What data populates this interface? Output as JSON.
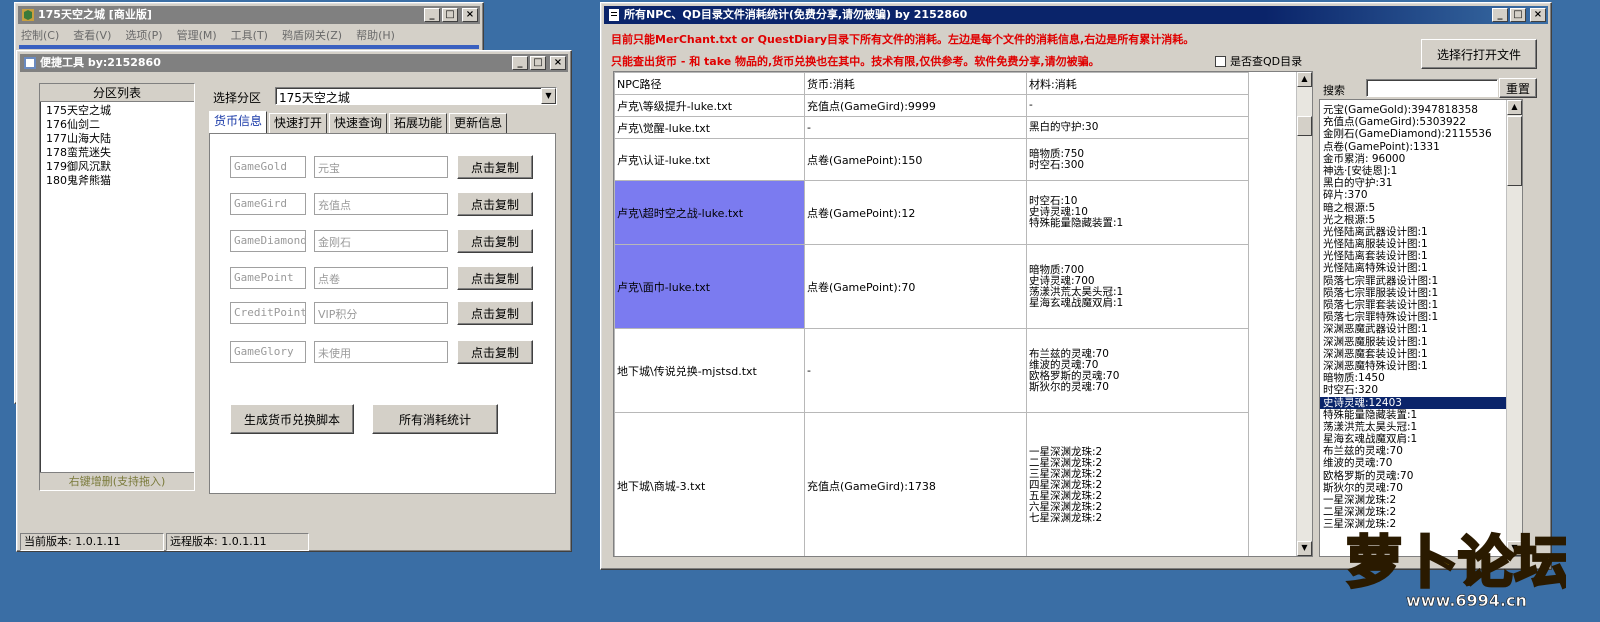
{
  "back_window": {
    "title": "175天空之城 [商业版]",
    "menu": [
      "控制(C)",
      "查看(V)",
      "选项(P)",
      "管理(M)",
      "工具(T)",
      "鸦盾网关(Z)",
      "帮助(H)"
    ]
  },
  "tool_window": {
    "title": "便捷工具    by:2152860",
    "zone_list_header": "分区列表",
    "zones": [
      "175天空之城",
      "176仙剑二",
      "177山海大陆",
      "178蛮荒迷失",
      "179御风沉默",
      "180鬼斧熊猫"
    ],
    "zone_list_footer": "右键增删(支持拖入)",
    "select_zone_label": "选择分区",
    "selected_zone": "175天空之城",
    "tabs": [
      "货币信息",
      "快速打开",
      "快速查询",
      "拓展功能",
      "更新信息"
    ],
    "currency_rows": [
      {
        "code": "GameGold",
        "name": "元宝",
        "button": "点击复制"
      },
      {
        "code": "GameGird",
        "name": "充值点",
        "button": "点击复制"
      },
      {
        "code": "GameDiamond",
        "name": "金刚石",
        "button": "点击复制"
      },
      {
        "code": "GamePoint",
        "name": "点卷",
        "button": "点击复制"
      },
      {
        "code": "CreditPoint",
        "name": "VIP积分",
        "button": "点击复制"
      },
      {
        "code": "GameGlory",
        "name": "未使用",
        "button": "点击复制"
      }
    ],
    "generate_button": "生成货币兑换脚本",
    "stats_button": "所有消耗统计",
    "status_current": "当前版本: 1.0.1.11",
    "status_remote": "远程版本: 1.0.1.11"
  },
  "stats_window": {
    "title": "所有NPC、QD目录文件消耗统计(免费分享,请勿被骗)        by 2152860",
    "notice_line1": "目前只能MerChant.txt or QuestDiary目录下所有文件的消耗。左边是每个文件的消耗信息,右边是所有累计消耗。",
    "notice_line2": "只能查出货币 - 和 take 物品的,货币兑换也在其中。技术有限,仅供参考。软件免费分享,请勿被骗。",
    "qd_checkbox_label": "是否查QD目录",
    "open_button": "选择行打开文件",
    "search_label": "搜索",
    "search_value": "",
    "reset_button": "重置",
    "columns": [
      "NPC路径",
      "货币:消耗",
      "材料:消耗"
    ],
    "rows": [
      {
        "path": "卢克\\等级提升-luke.txt",
        "currency": "充值点(GameGird):9999",
        "materials": [
          "-"
        ],
        "selected": false
      },
      {
        "path": "卢克\\觉醒-luke.txt",
        "currency": "-",
        "materials": [
          "黑白的守护:30"
        ],
        "selected": false
      },
      {
        "path": "卢克\\认证-luke.txt",
        "currency": "点卷(GamePoint):150",
        "materials": [
          "暗物质:750",
          "时空石:300"
        ],
        "selected": false
      },
      {
        "path": "卢克\\超时空之战-luke.txt",
        "currency": "点卷(GamePoint):12",
        "materials": [
          "时空石:10",
          "史诗灵魂:10",
          "特殊能量隐藏装置:1"
        ],
        "selected": true
      },
      {
        "path": "卢克\\面巾-luke.txt",
        "currency": "点卷(GamePoint):70",
        "materials": [
          "暗物质:700",
          "史诗灵魂:700",
          "荡漾洪荒太昊头冠:1",
          "星海玄魂战魔双肩:1"
        ],
        "selected": true
      },
      {
        "path": "地下城\\传说兑换-mjstsd.txt",
        "currency": "-",
        "materials": [
          "布兰兹的灵魂:70",
          "维波的灵魂:70",
          "欧格罗斯的灵魂:70",
          "斯狄尔的灵魂:70"
        ],
        "selected": false
      },
      {
        "path": "地下城\\商城-3.txt",
        "currency": "充值点(GameGird):1738",
        "materials": [
          "一星深渊龙珠:2",
          "二星深渊龙珠:2",
          "三星深渊龙珠:2",
          "四星深渊龙珠:2",
          "五星深渊龙珠:2",
          "六星深渊龙珠:2",
          "七星深渊龙珠:2"
        ],
        "selected": false
      }
    ],
    "totals": [
      "元宝(GameGold):3947818358",
      "充值点(GameGird):5303922",
      "金刚石(GameDiamond):2115536",
      "点卷(GamePoint):1331",
      "金币累消: 96000",
      "神选·[安徒恩]:1",
      "黑白的守护:31",
      "碎片:370",
      "暗之根源:5",
      "光之根源:5",
      "光怪陆离武器设计图:1",
      "光怪陆离服装设计图:1",
      "光怪陆离套装设计图:1",
      "光怪陆离特殊设计图:1",
      "陨落七宗罪武器设计图:1",
      "陨落七宗罪服装设计图:1",
      "陨落七宗罪套装设计图:1",
      "陨落七宗罪特殊设计图:1",
      "深渊恶魔武器设计图:1",
      "深渊恶魔服装设计图:1",
      "深渊恶魔套装设计图:1",
      "深渊恶魔特殊设计图:1",
      "暗物质:1450",
      "时空石:320",
      "史诗灵魂:12403",
      "特殊能量隐藏装置:1",
      "荡漾洪荒太昊头冠:1",
      "星海玄魂战魔双肩:1",
      "布兰兹的灵魂:70",
      "维波的灵魂:70",
      "欧格罗斯的灵魂:70",
      "斯狄尔的灵魂:70",
      "一星深渊龙珠:2",
      "二星深渊龙珠:2",
      "三星深渊龙珠:2"
    ],
    "totals_highlight_index": 24
  },
  "watermark": {
    "brand": "萝卜论坛",
    "url": "www.6994.cn"
  }
}
